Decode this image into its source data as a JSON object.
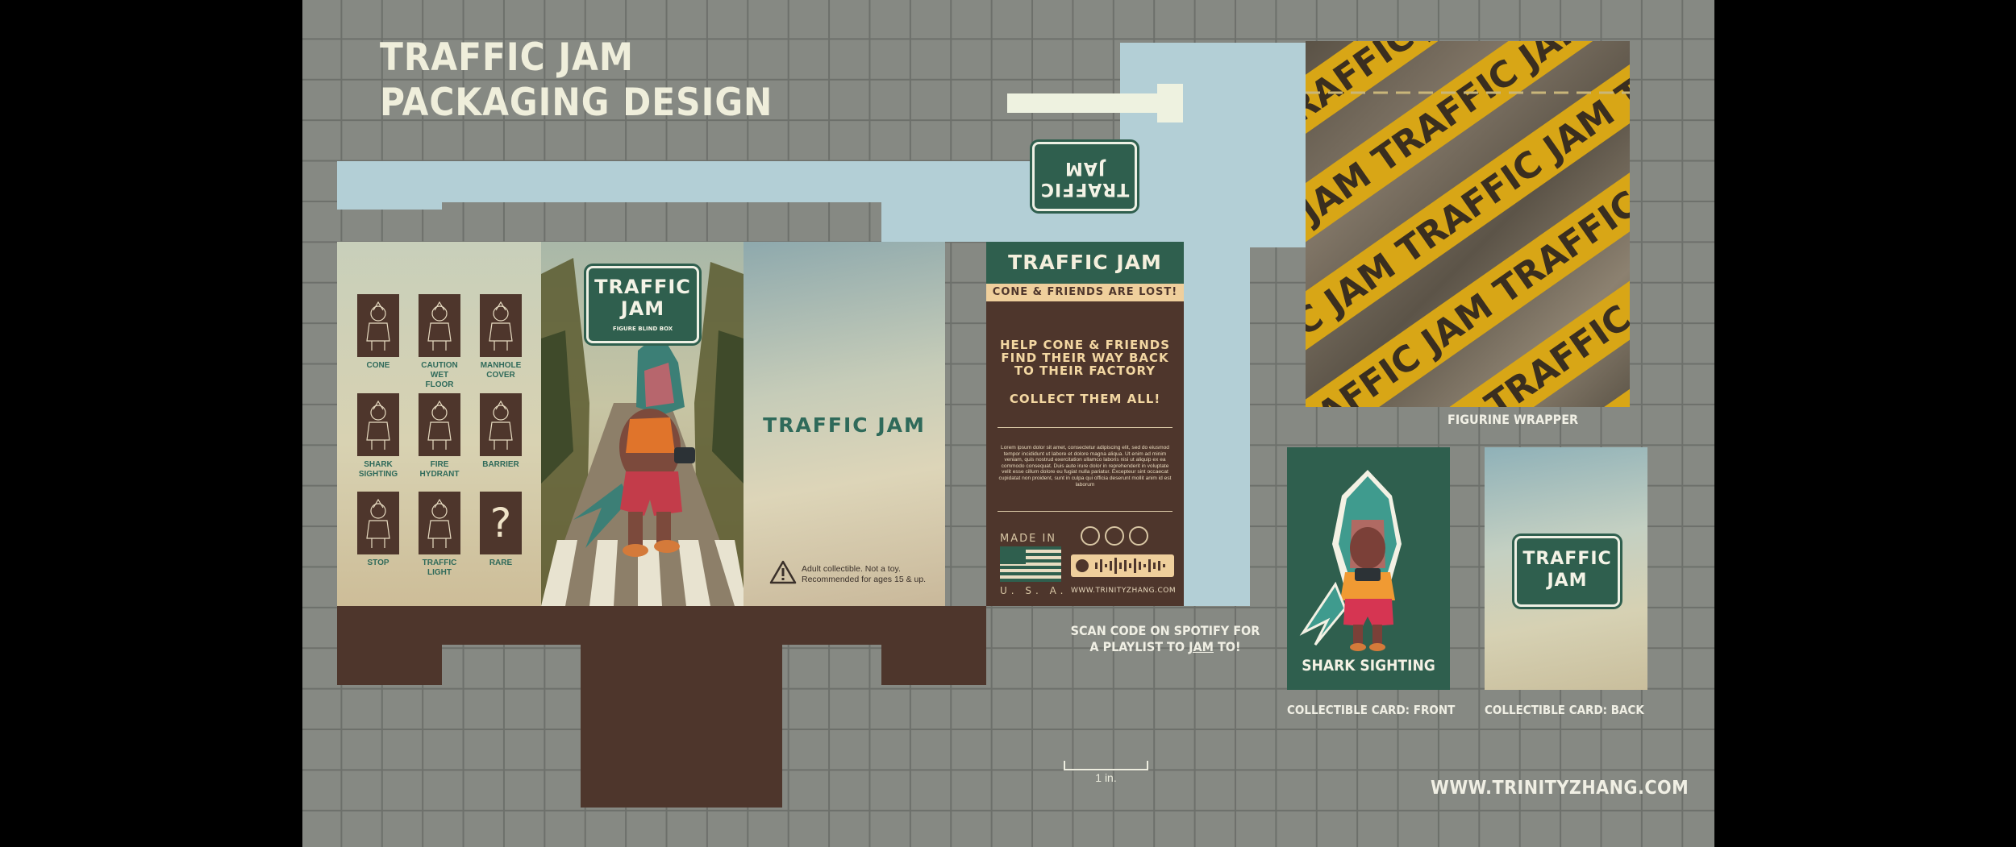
{
  "page": {
    "title_line1": "TRAFFIC JAM",
    "title_line2": "PACKAGING DESIGN",
    "website_footer": "WWW.TRINITYZHANG.COM",
    "scale_label": "1 in."
  },
  "colors": {
    "background_grid": "#868983",
    "box_brown": "#4e362c",
    "sign_green": "#2f5f4e",
    "flap_blue": "#b3cfd6",
    "cream": "#efeedb",
    "tape_yellow": "#d8a616"
  },
  "side_panel": {
    "items": [
      {
        "label_lines": [
          "CONE"
        ],
        "icon": "cone-figure-icon"
      },
      {
        "label_lines": [
          "CAUTION",
          "WET",
          "FLOOR"
        ],
        "icon": "wet-floor-figure-icon"
      },
      {
        "label_lines": [
          "MANHOLE",
          "COVER"
        ],
        "icon": "manhole-figure-icon"
      },
      {
        "label_lines": [
          "SHARK",
          "SIGHTING"
        ],
        "icon": "shark-figure-icon"
      },
      {
        "label_lines": [
          "FIRE",
          "HYDRANT"
        ],
        "icon": "hydrant-figure-icon"
      },
      {
        "label_lines": [
          "BARRIER"
        ],
        "icon": "barrier-figure-icon"
      },
      {
        "label_lines": [
          "STOP"
        ],
        "icon": "stop-figure-icon"
      },
      {
        "label_lines": [
          "TRAFFIC",
          "LIGHT"
        ],
        "icon": "traffic-light-figure-icon"
      },
      {
        "label_lines": [
          "RARE"
        ],
        "icon": "question-mark-icon"
      }
    ]
  },
  "front_panel": {
    "sign_line1": "TRAFFIC",
    "sign_line2": "JAM",
    "sign_sub": "FIGURE BLIND BOX",
    "illustration": "shark-hoodie-character-illustration"
  },
  "right_panel": {
    "name": "TRAFFIC JAM",
    "warning_line1": "Adult collectible. Not a toy.",
    "warning_line2": "Recommended for ages 15 & up.",
    "warning_icon": "warning-triangle-icon"
  },
  "top_flap": {
    "sign_line1": "TRAFFIC",
    "sign_line2": "JAM"
  },
  "back_panel": {
    "header": "TRAFFIC JAM",
    "subheader": "CONE & FRIENDS ARE LOST!",
    "help_line1": "HELP CONE & FRIENDS",
    "help_line2": "FIND THEIR WAY BACK",
    "help_line3": "TO THEIR FACTORY",
    "collect": "COLLECT THEM ALL!",
    "lorem": "Lorem ipsum dolor sit amet, consectetur adipiscing elit, sed do eiusmod tempor incididunt ut labore et dolore magna aliqua. Ut enim ad minim veniam, quis nostrud exercitation ullamco laboris nisi ut aliquip ex ea commodo consequat. Duis aute irure dolor in reprehenderit in voluptate velit esse cillum dolore eu fugiat nulla pariatur. Excepteur sint occaecat cupidatat non proident, sunt in culpa qui officia deserunt mollit anim id est laborum",
    "made_in": "MADE IN",
    "usa": "U. S. A.",
    "website": "WWW.TRINITYZHANG.COM",
    "flag_icon": "us-flag-icon",
    "spotify_icon": "spotify-code-icon"
  },
  "spotify_note": {
    "line1": "SCAN CODE ON SPOTIFY FOR",
    "line2_pre": "A PLAYLIST TO ",
    "line2_link": "JAM",
    "line2_post": " TO!"
  },
  "wrapper": {
    "tape_text": "TRAFFIC JAM TRAFFIC JAM TRAFFIC JAM TRAFFIC JAM",
    "caption": "FIGURINE WRAPPER"
  },
  "card_front": {
    "name": "SHARK SIGHTING",
    "caption": "COLLECTIBLE CARD: FRONT",
    "illustration": "shark-character-card-icon"
  },
  "card_back": {
    "sign_line1": "TRAFFIC",
    "sign_line2": "JAM",
    "caption": "COLLECTIBLE CARD: BACK"
  }
}
